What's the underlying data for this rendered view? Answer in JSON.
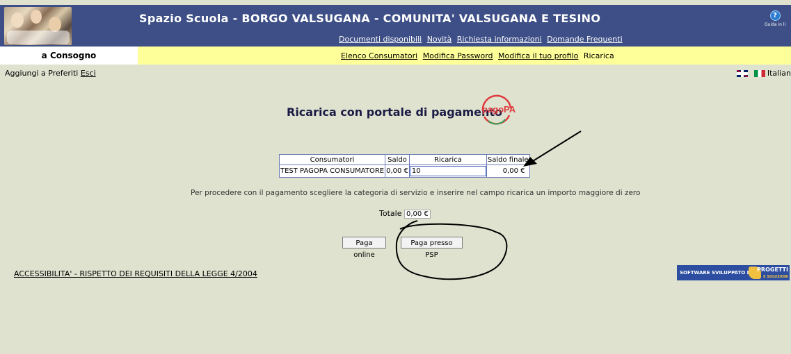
{
  "header": {
    "title": "Spazio Scuola - BORGO VALSUGANA - COMUNITA' VALSUGANA E TESINO",
    "links": [
      "Documenti disponibili",
      "Novità",
      "Richiesta informazioni",
      "Domande Frequenti"
    ],
    "help_label": "Guida in li"
  },
  "nav": {
    "left_label": "a Consogno",
    "links": [
      "Elenco Consumatori",
      "Modifica Password",
      "Modifica il tuo profilo"
    ],
    "current": "Ricarica"
  },
  "prefs": {
    "favorites": "Aggiungi a Preferiti",
    "logout": "Esci",
    "language": "Italian"
  },
  "page": {
    "title": "Ricarica con portale di pagamento",
    "logo_text": "pagoPA"
  },
  "table": {
    "headers": [
      "Consumatori",
      "Saldo",
      "Ricarica",
      "Saldo finale"
    ],
    "row": {
      "consumatore": "TEST PAGOPA CONSUMATORE",
      "saldo": "0,00 €",
      "ricarica": "10",
      "saldo_finale": "0,00 €"
    }
  },
  "instructions": "Per procedere con il pagamento scegliere la categoria di servizio e inserire nel campo ricarica un importo maggiore di zero",
  "totale": {
    "label": "Totale",
    "value": "0,00 €"
  },
  "buttons": {
    "online": "Paga online",
    "psp": "Paga presso PSP"
  },
  "footer": {
    "accessibility": "ACCESSIBILITA' - RISPETTO DEI REQUISITI DELLA LEGGE 4/2004",
    "sponsor_text": "SOFTWARE SVILUPPATO DA",
    "sponsor_brand": "PROGETTI",
    "sponsor_sub": "E SOLUZIONI"
  },
  "colors": {
    "header_bg": "#3d4f86",
    "nav_bg": "#ffff99",
    "page_bg": "#dfe2cf",
    "pagopa_red": "#e03a3e",
    "pagopa_green": "#3aa35a"
  }
}
